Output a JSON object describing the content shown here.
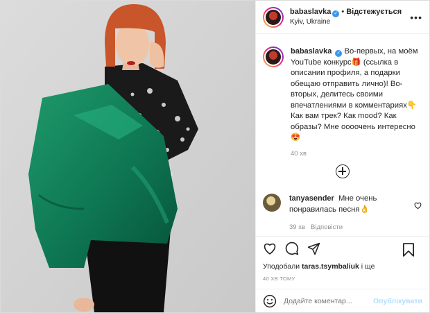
{
  "post": {
    "username": "babaslavka",
    "follow_label": "Відстежується",
    "location": "Kyiv, Ukraine",
    "caption": "Во-первых, на моём YouTube конкурс🎁 (ссылка в описании профиля, а подарки обещаю отправить лично)! Во-вторых, делитесь своими впечатлениями в комментариях👇 Как вам трек? Как mood? Как образы? Мне оооочень интересно😍",
    "caption_age": "40 хв",
    "comments": [
      {
        "username": "tanyasender",
        "text": "Мне очень понравилась песня👌",
        "age": "39 хв",
        "reply_label": "Відповісти"
      }
    ],
    "likes_prefix": "Уподобали",
    "likes_user": "taras.tsymbaliuk",
    "likes_suffix": "і ще",
    "timestamp": "40 ХВ ТОМУ",
    "comment_placeholder": "Додайте коментар...",
    "publish_label": "Опублікувати"
  },
  "icons": {
    "header_more": "more-options-icon",
    "load_more": "load-more-comments-icon",
    "like": "heart-icon",
    "comment": "comment-icon",
    "share": "share-icon",
    "save": "bookmark-icon",
    "emoji": "emoji-icon"
  },
  "colors": {
    "verified": "#3897f0",
    "publish_disabled": "#b2dffc",
    "jacket": "#0f7a55",
    "hair": "#c9552a"
  }
}
